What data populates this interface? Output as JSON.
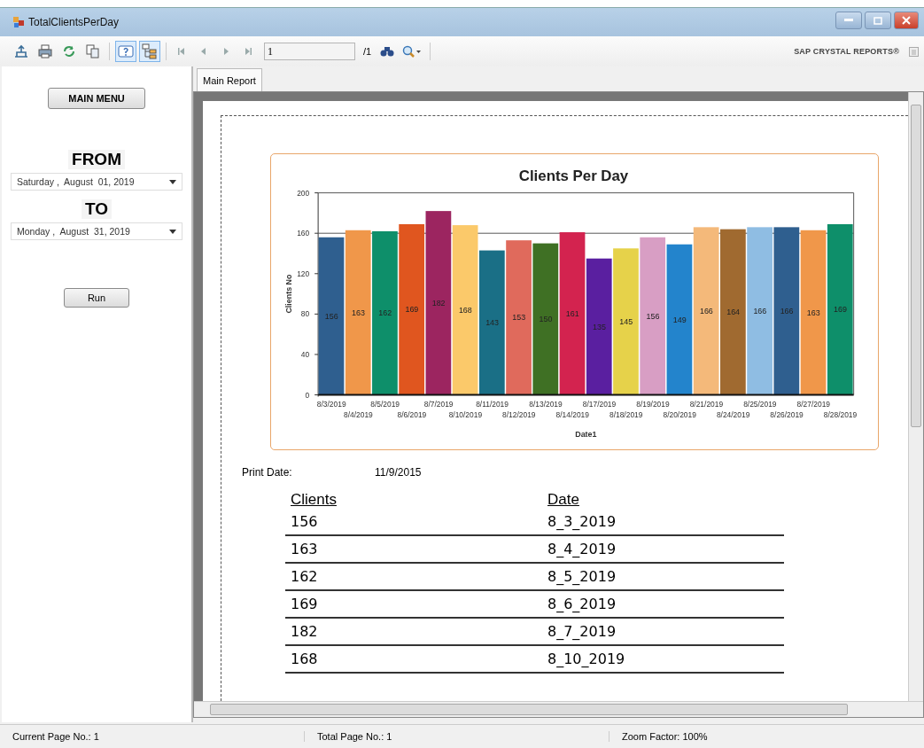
{
  "window": {
    "title": "TotalClientsPerDay"
  },
  "toolbar": {
    "buttons": [
      {
        "kind": "export",
        "selected": false
      },
      {
        "kind": "print",
        "selected": false
      },
      {
        "kind": "refresh",
        "selected": false
      },
      {
        "kind": "copy",
        "selected": false
      },
      {
        "kind": "help",
        "selected": true
      },
      {
        "kind": "tree",
        "selected": true
      }
    ],
    "nav": [
      {
        "kind": "first"
      },
      {
        "kind": "prev"
      },
      {
        "kind": "next"
      },
      {
        "kind": "last"
      }
    ],
    "page_field": "1",
    "page_total": "/1",
    "brand": "SAP CRYSTAL REPORTS®"
  },
  "sidebar": {
    "main_menu_button": "MAIN MENU",
    "from_label": "FROM",
    "from_date": "Saturday ,  August  01, 2019",
    "to_label": "TO",
    "to_date": "Monday ,  August  31, 2019",
    "run_button": "Run"
  },
  "tabs": [
    {
      "label": "Main Report",
      "selected": true
    }
  ],
  "report": {
    "chart_data": {
      "type": "bar",
      "title": "Clients Per Day",
      "xlabel": "Date1",
      "ylabel": "Clients No",
      "categories": [
        "8/3/2019",
        "8/4/2019",
        "8/5/2019",
        "8/6/2019",
        "8/7/2019",
        "8/10/2019",
        "8/11/2019",
        "8/12/2019",
        "8/13/2019",
        "8/14/2019",
        "8/17/2019",
        "8/18/2019",
        "8/19/2019",
        "8/20/2019",
        "8/21/2019",
        "8/24/2019",
        "8/25/2019",
        "8/26/2019",
        "8/27/2019",
        "8/28/2019"
      ],
      "series": [
        {
          "values": [
            156,
            163,
            162,
            169,
            182,
            168,
            143,
            153,
            150,
            161,
            135,
            145,
            156,
            149,
            166,
            164,
            166,
            166,
            163,
            169
          ]
        }
      ],
      "colors": [
        "#2f5f8f",
        "#f0974a",
        "#0e8f6a",
        "#e0561f",
        "#9c2560",
        "#fbc96a",
        "#1a6f86",
        "#e06a5c",
        "#3f7024",
        "#d3234f",
        "#5a1fa0",
        "#e6d24a",
        "#d89ec4",
        "#2384cc",
        "#f4b97a",
        "#a06a30",
        "#8fbde3",
        "#2f5f8f",
        "#f0974a",
        "#0e8f6a"
      ],
      "ylim": [
        0,
        200
      ],
      "yticks": [
        0,
        40,
        80,
        120,
        160,
        200
      ],
      "data_labels": true
    },
    "print_date_label": "Print Date:",
    "print_date": "11/9/2015",
    "table": {
      "columns": [
        "Clients",
        "Date"
      ],
      "rows": [
        {
          "clients": "156",
          "date": "8_3_2019"
        },
        {
          "clients": "163",
          "date": "8_4_2019"
        },
        {
          "clients": "162",
          "date": "8_5_2019"
        },
        {
          "clients": "169",
          "date": "8_6_2019"
        },
        {
          "clients": "182",
          "date": "8_7_2019"
        },
        {
          "clients": "168",
          "date": "8_10_2019"
        }
      ]
    }
  },
  "status_bar": [
    "Current Page No.: 1",
    "Total Page No.: 1",
    "Zoom Factor: 100%"
  ]
}
